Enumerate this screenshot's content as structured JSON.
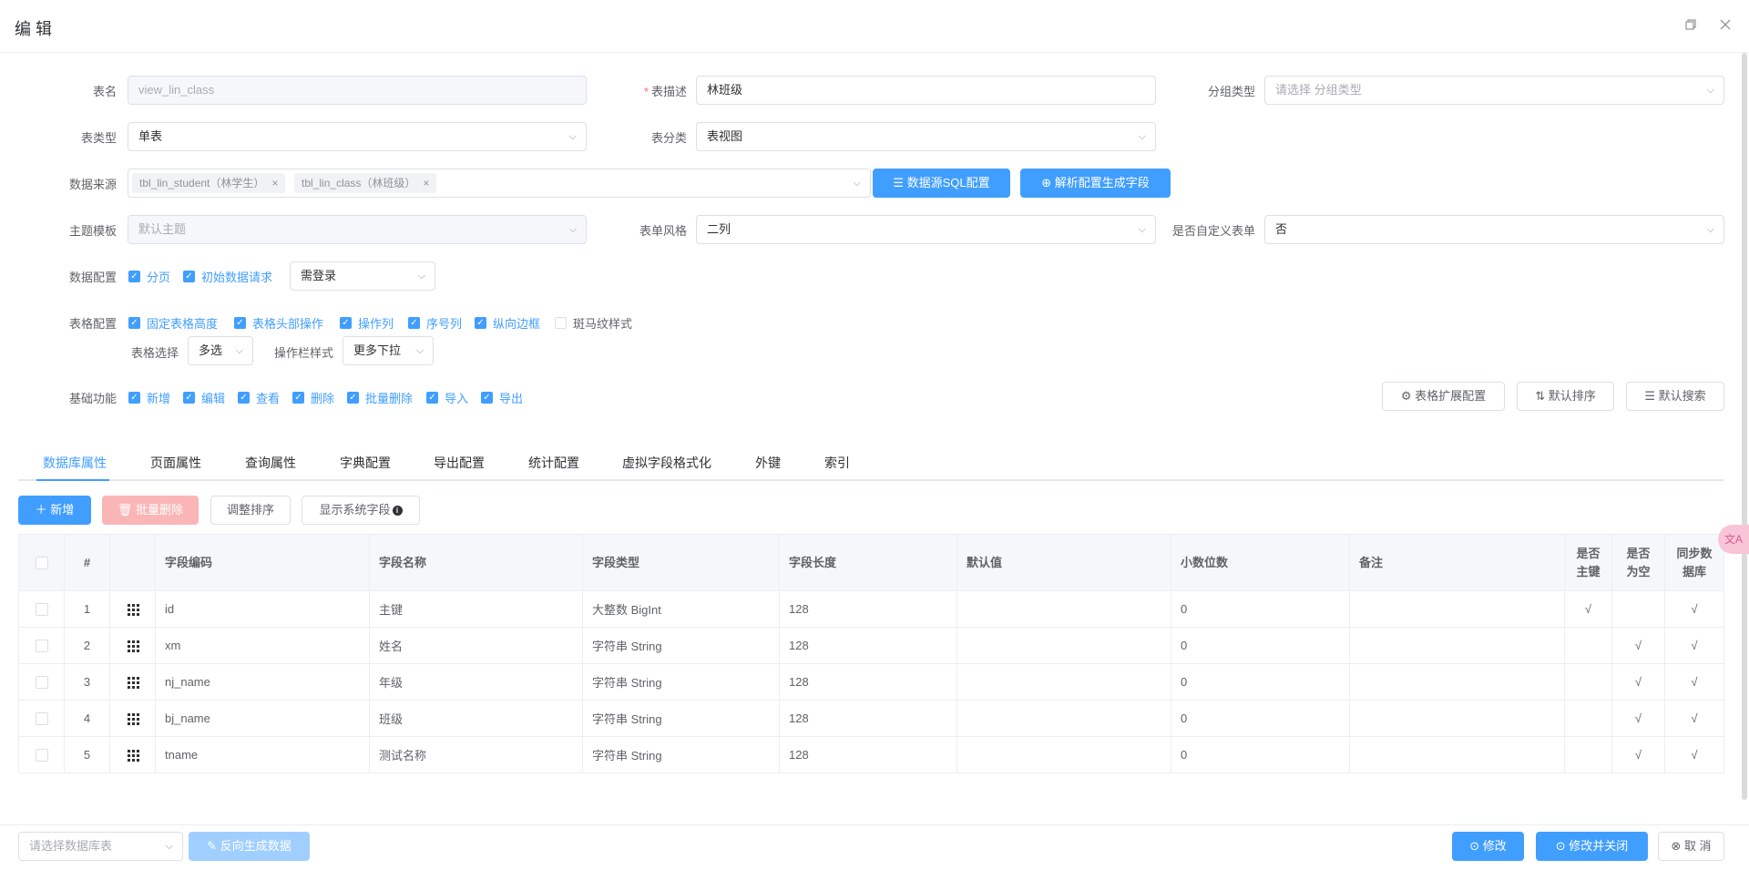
{
  "dialog": {
    "title": "编 辑",
    "maximize_icon": "maximize-icon",
    "close_icon": "close-icon"
  },
  "form": {
    "table_name": {
      "label": "表名",
      "value": "view_lin_class"
    },
    "table_desc": {
      "label": "表描述",
      "required_mark": "*",
      "value": "林班级"
    },
    "group_type": {
      "label": "分组类型",
      "placeholder": "请选择 分组类型"
    },
    "table_type": {
      "label": "表类型",
      "value": "单表"
    },
    "table_category": {
      "label": "表分类",
      "value": "表视图"
    },
    "data_source": {
      "label": "数据来源",
      "tags": [
        "tbl_lin_student（林学生）",
        "tbl_lin_class（林班级）"
      ],
      "sql_button": "数据源SQL配置",
      "parse_button": "解析配置生成字段"
    },
    "theme": {
      "label": "主题模板",
      "placeholder": "默认主题"
    },
    "form_style": {
      "label": "表单风格",
      "value": "二列"
    },
    "custom_form": {
      "label": "是否自定义表单",
      "value": "否"
    },
    "data_config": {
      "label": "数据配置",
      "options": [
        {
          "label": "分页",
          "checked": true
        },
        {
          "label": "初始数据请求",
          "checked": true
        }
      ],
      "login_select": "需登录"
    },
    "table_config": {
      "label": "表格配置",
      "options": [
        {
          "label": "固定表格高度",
          "checked": true
        },
        {
          "label": "表格头部操作",
          "checked": true
        },
        {
          "label": "操作列",
          "checked": true
        },
        {
          "label": "序号列",
          "checked": true
        },
        {
          "label": "纵向边框",
          "checked": true
        },
        {
          "label": "斑马纹样式",
          "checked": false
        }
      ],
      "select_label": "表格选择",
      "select_value": "多选",
      "op_style_label": "操作栏样式",
      "op_style_value": "更多下拉"
    },
    "basic_func": {
      "label": "基础功能",
      "options": [
        {
          "label": "新增",
          "checked": true
        },
        {
          "label": "编辑",
          "checked": true
        },
        {
          "label": "查看",
          "checked": true
        },
        {
          "label": "删除",
          "checked": true
        },
        {
          "label": "批量删除",
          "checked": true
        },
        {
          "label": "导入",
          "checked": true
        },
        {
          "label": "导出",
          "checked": true
        }
      ],
      "ext_config": "表格扩展配置",
      "default_sort": "默认排序",
      "default_search": "默认搜索"
    }
  },
  "tabs": [
    "数据库属性",
    "页面属性",
    "查询属性",
    "字典配置",
    "导出配置",
    "统计配置",
    "虚拟字段格式化",
    "外键",
    "索引"
  ],
  "toolbar": {
    "add": "新增",
    "batch_delete": "批量删除",
    "adjust_sort": "调整排序",
    "show_system": "显示系统字段"
  },
  "table": {
    "headers": [
      "#",
      "字段编码",
      "字段名称",
      "字段类型",
      "字段长度",
      "默认值",
      "小数位数",
      "备注"
    ],
    "h_pk": [
      "是否",
      "主键"
    ],
    "h_null": [
      "是否",
      "为空"
    ],
    "h_sync": [
      "同步数",
      "据库"
    ],
    "rows": [
      {
        "no": "1",
        "code": "id",
        "name": "主键",
        "type": "大整数 BigInt",
        "length": "128",
        "default": "",
        "decimal": "0",
        "remark": "",
        "pk": "√",
        "nullable": "",
        "sync": "√"
      },
      {
        "no": "2",
        "code": "xm",
        "name": "姓名",
        "type": "字符串 String",
        "length": "128",
        "default": "",
        "decimal": "0",
        "remark": "",
        "pk": "",
        "nullable": "√",
        "sync": "√"
      },
      {
        "no": "3",
        "code": "nj_name",
        "name": "年级",
        "type": "字符串 String",
        "length": "128",
        "default": "",
        "decimal": "0",
        "remark": "",
        "pk": "",
        "nullable": "√",
        "sync": "√"
      },
      {
        "no": "4",
        "code": "bj_name",
        "name": "班级",
        "type": "字符串 String",
        "length": "128",
        "default": "",
        "decimal": "0",
        "remark": "",
        "pk": "",
        "nullable": "√",
        "sync": "√"
      },
      {
        "no": "5",
        "code": "tname",
        "name": "测试名称",
        "type": "字符串 String",
        "length": "128",
        "default": "",
        "decimal": "0",
        "remark": "",
        "pk": "",
        "nullable": "√",
        "sync": "√"
      }
    ]
  },
  "footer": {
    "db_table_placeholder": "请选择数据库表",
    "reverse_generate": "反向生成数据",
    "modify": "修改",
    "modify_close": "修改并关闭",
    "cancel": "取 消"
  },
  "floating": {
    "translate_icon": "translate-icon"
  }
}
